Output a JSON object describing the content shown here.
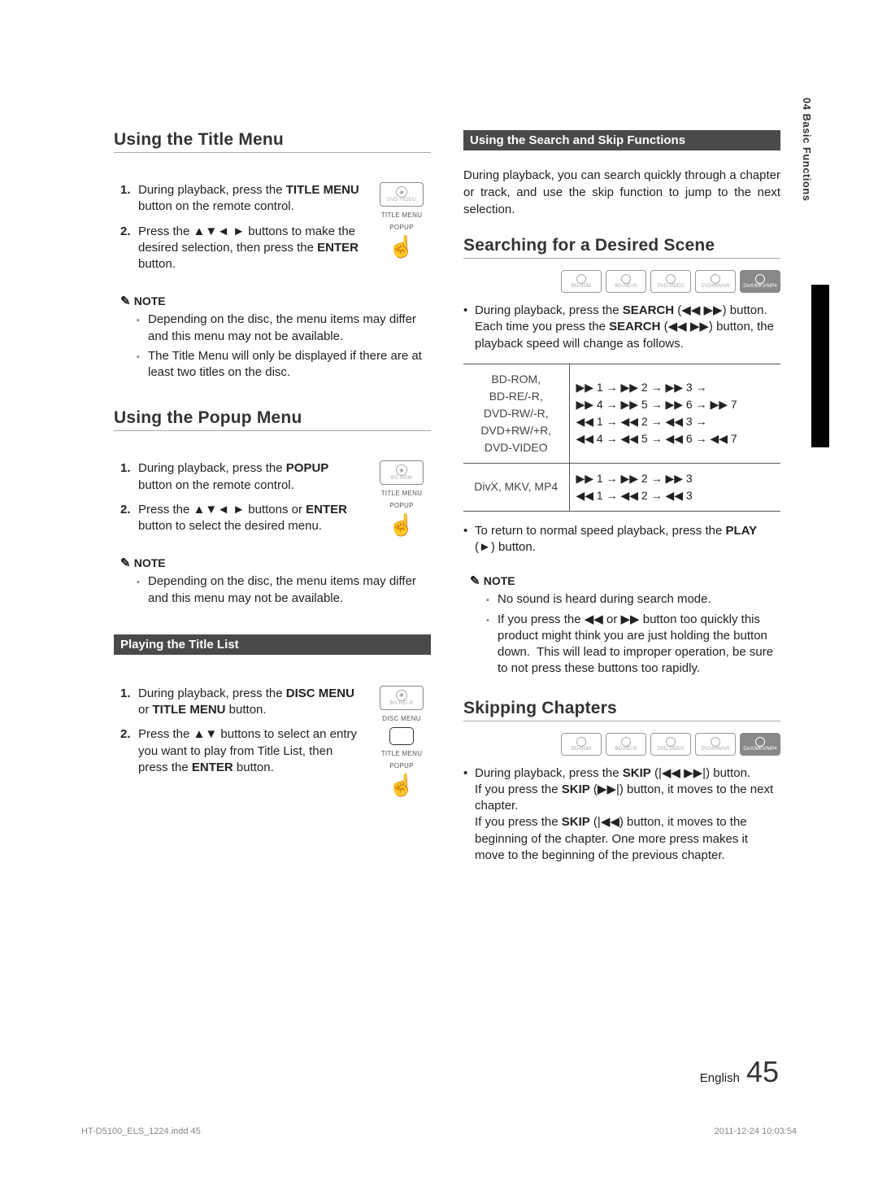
{
  "sideTab": "04   Basic Functions",
  "titleMenu": {
    "heading": "Using the Title Menu",
    "discLabel": "DVD-VIDEO",
    "iconLabel1": "TITLE MENU",
    "iconLabel2": "POPUP",
    "step1": "During playback, press the TITLE MENU button on the remote control.",
    "step2": "Press the ▲▼◄ ► buttons to make the desired selection, then press the ENTER button.",
    "noteLabel": "NOTE",
    "note1": "Depending on the disc, the menu items may differ and this menu may not be available.",
    "note2": "The Title Menu will only be displayed if there are at least two titles on the disc."
  },
  "popupMenu": {
    "heading": "Using the Popup Menu",
    "discLabel": "BD-ROM",
    "iconLabel1": "TITLE MENU",
    "iconLabel2": "POPUP",
    "step1": "During playback, press the POPUP button on the remote control.",
    "step2": "Press the ▲▼◄ ► buttons or ENTER button to select the desired menu.",
    "noteLabel": "NOTE",
    "note1": "Depending on the disc, the menu items may differ and this menu may not be available."
  },
  "titleList": {
    "bar": "Playing the Title List",
    "discLabel": "BD-RE/-R",
    "iconLabel1": "DISC MENU",
    "iconLabel2": "TITLE MENU",
    "iconLabel3": "POPUP",
    "step1": "During playback, press the DISC MENU or TITLE MENU button.",
    "step2": "Press the ▲▼ buttons to select an entry you want to play from Title List, then press the ENTER button."
  },
  "searchSkip": {
    "bar": "Using the Search and Skip Functions",
    "intro": "During playback, you can search quickly through a chapter or track, and use the skip function to jump to the next selection."
  },
  "searchScene": {
    "heading": "Searching for a Desired Scene",
    "discs": [
      "BD-ROM",
      "BD-RE/-R",
      "DVD-VIDEO",
      "DVD±RW/±R",
      "DivX/MKV/MP4"
    ],
    "bullet1": "During playback, press the SEARCH (◀◀ ▶▶) button.",
    "bullet1b": "Each time you press the SEARCH (◀◀ ▶▶) button, the playback speed will change as follows.",
    "tableLeft1": "BD-ROM,\nBD-RE/-R,\nDVD-RW/-R,\nDVD+RW/+R,\nDVD-VIDEO",
    "tableRight1": "▶▶ 1 → ▶▶ 2 → ▶▶ 3 →\n▶▶ 4 → ▶▶ 5 → ▶▶ 6 → ▶▶ 7\n◀◀ 1 → ◀◀ 2 → ◀◀ 3 →\n◀◀ 4 → ◀◀ 5 → ◀◀ 6 → ◀◀ 7",
    "tableLeft2": "DivX, MKV, MP4",
    "tableRight2": "▶▶ 1 → ▶▶ 2 → ▶▶ 3\n◀◀ 1 → ◀◀ 2 → ◀◀ 3",
    "bullet2": "To return to normal speed playback, press the PLAY (►) button.",
    "noteLabel": "NOTE",
    "note1": "No sound is heard during search mode.",
    "note2": "If you press the ◀◀ or ▶▶ button too quickly this product might think you are just holding the button down.  This will lead to improper operation, be sure to not press these buttons too rapidly."
  },
  "skip": {
    "heading": "Skipping Chapters",
    "discs": [
      "BD-ROM",
      "BD-RE/-R",
      "DVD-VIDEO",
      "DVD±RW/±R",
      "DivX/MKV/MP4"
    ],
    "bullet1": "During playback, press the SKIP (|◀◀ ▶▶|) button.",
    "bullet1b": "If you press the SKIP (▶▶|) button, it moves to the next chapter.",
    "bullet1c": "If you press the SKIP (|◀◀) button, it moves to the beginning of the chapter. One more press makes it move to the beginning of the previous chapter."
  },
  "footer": {
    "lang": "English",
    "page": "45"
  },
  "meta": {
    "file": "HT-D5100_ELS_1224.indd   45",
    "date": "2011-12-24    10:03:54"
  }
}
